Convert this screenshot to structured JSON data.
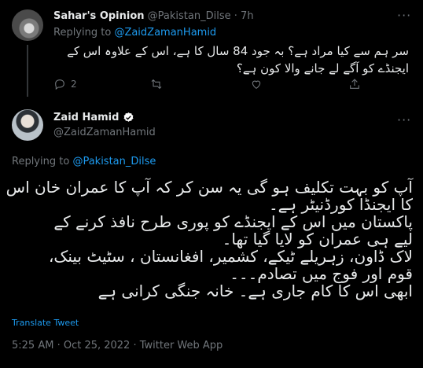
{
  "reply": {
    "name": "Sahar's Opinion",
    "handle": "@Pakistan_Dilse",
    "separator": "·",
    "time": "7h",
    "replying_prefix": "Replying to",
    "replying_to": "@ZaidZamanHamid",
    "text": "سر ہم سے کیا مراد ہے؟ بہ جود 84 سال کا ہے، اس کے علاوہ اس کے ایجنڈے کو آگے لے جانے والا کون ہے؟",
    "reply_count": "2",
    "retweet_count": "",
    "like_count": ""
  },
  "main": {
    "name": "Zaid Hamid",
    "handle": "@ZaidZamanHamid",
    "replying_prefix": "Replying to",
    "replying_to": "@Pakistan_Dilse",
    "lines": [
      "آپ کو بہت تکلیف ہو گی یہ سن کر کہ آپ کا عمران خان اس",
      "کا ایجنڈا کورڈنیٹر ہے۔",
      "پاکستان میں اس کے ایجنڈے کو پوری طرح نافذ کرنے کے",
      "لیے ہی عمران کو لایا گیا تھا۔",
      "لاک ڈاون، زہریلے ٹیکے، کشمیر، افغانستان ، سٹیٹ بینک،",
      "قوم اور فوج میں تصادم۔۔۔",
      "ابھی اس کا کام جاری ہے۔ خانہ جنگی کرانی ہے"
    ],
    "translate": "Translate Tweet",
    "timestamp": "5:25 AM · Oct 25, 2022 · Twitter Web App"
  },
  "icons": [
    "more-icon",
    "reply-icon",
    "retweet-icon",
    "like-icon",
    "share-icon",
    "verified-icon"
  ],
  "colors": {
    "background": "#000000",
    "text": "#e7e9ea",
    "muted": "#71767b",
    "link": "#1d9bf0"
  }
}
